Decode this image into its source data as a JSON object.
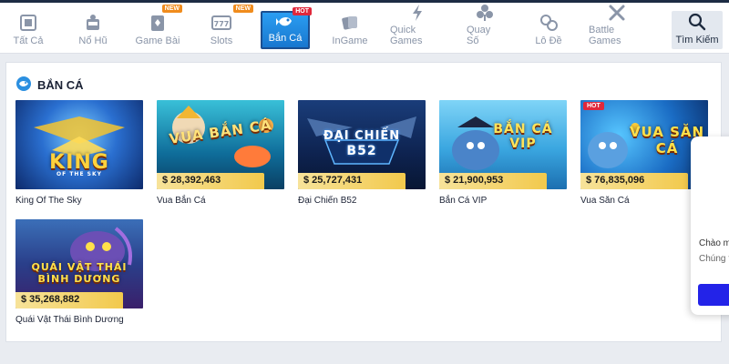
{
  "nav": {
    "items": [
      {
        "label": "Tất Cả",
        "icon": "grid-icon",
        "tag": ""
      },
      {
        "label": "Nổ Hũ",
        "icon": "slot-machine-icon",
        "tag": ""
      },
      {
        "label": "Game Bài",
        "icon": "cards-icon",
        "tag": "NEW"
      },
      {
        "label": "Slots",
        "icon": "777-icon",
        "tag": "NEW"
      },
      {
        "label": "Bắn Cá",
        "icon": "fish-icon",
        "tag": "HOT"
      },
      {
        "label": "InGame",
        "icon": "ingame-cards-icon",
        "tag": ""
      },
      {
        "label": "Quick Games",
        "icon": "lightning-icon",
        "tag": ""
      },
      {
        "label": "Quay Số",
        "icon": "diamond-icon",
        "tag": ""
      },
      {
        "label": "Lô Đề",
        "icon": "lottery-balls-icon",
        "tag": ""
      },
      {
        "label": "Battle Games",
        "icon": "crossed-swords-icon",
        "tag": ""
      }
    ],
    "search_label": "Tìm Kiếm",
    "active": "Bắn Cá"
  },
  "section": {
    "title": "BẮN CÁ"
  },
  "games": [
    {
      "name": "King Of The Sky",
      "logo": "KING",
      "logo_sub": "OF THE SKY",
      "jackpot": "",
      "hot": false,
      "theme": "blue-yellow"
    },
    {
      "name": "Vua Bắn Cá",
      "logo": "VUA BẮN CÁ",
      "logo_sub": "",
      "jackpot": "$ 28,392,463",
      "hot": false,
      "theme": "teal-gold"
    },
    {
      "name": "Đại Chiến B52",
      "logo": "ĐẠI CHIẾN",
      "logo_sub": "B52",
      "jackpot": "$ 25,727,431",
      "hot": false,
      "theme": "navy"
    },
    {
      "name": "Bắn Cá VIP",
      "logo": "BẮN CÁ VIP",
      "logo_sub": "",
      "jackpot": "$ 21,900,953",
      "hot": false,
      "theme": "sky"
    },
    {
      "name": "Vua Săn Cá",
      "logo": "VUA SĂN CÁ",
      "logo_sub": "",
      "jackpot": "$ 76,835,096",
      "hot": true,
      "theme": "ocean"
    },
    {
      "name": "Quái Vật Thái Bình Dương",
      "logo": "QUÁI VẬT THÁI BÌNH DƯƠNG",
      "logo_sub": "",
      "jackpot": "$ 35,268,882",
      "hot": false,
      "theme": "purple"
    }
  ],
  "card_hot_label": "HOT",
  "chat": {
    "greeting": "Chào m",
    "message": "Chúng t bạn?"
  },
  "colors": {
    "nav_active": "#1877cf",
    "jackpot_bg": "#f2c94c",
    "tag_new": "#f08c1d",
    "tag_hot": "#e0283b",
    "chat_button": "#2323e8"
  }
}
